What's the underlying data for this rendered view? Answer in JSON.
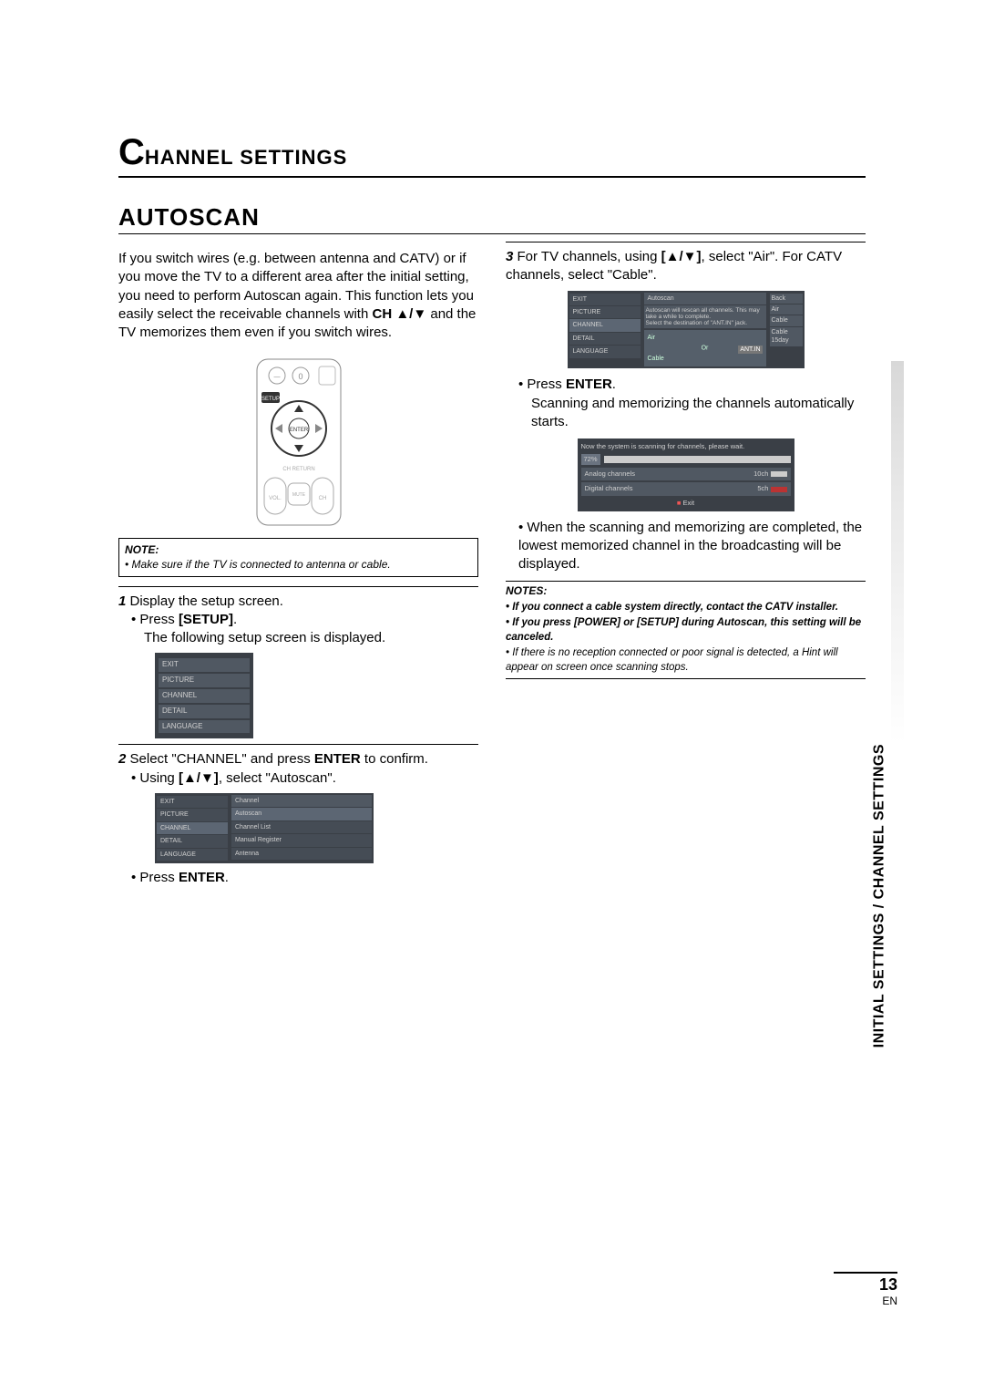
{
  "title": {
    "big": "C",
    "rest": "HANNEL SETTINGS"
  },
  "section": "AUTOSCAN",
  "side_tab": "INITIAL SETTINGS / CHANNEL SETTINGS",
  "intro": "If you switch wires (e.g. between antenna and CATV) or if you move the TV to a different area after the initial setting, you need to perform Autoscan again. This function lets you easily select the receivable channels with ",
  "intro_key": "CH ▲/▼",
  "intro2": " and the TV memorizes them even if you switch wires.",
  "note_title": "NOTE:",
  "note_body": "• Make sure if the TV is connected to antenna or cable.",
  "step1": {
    "n": "1",
    "text": "Display the setup screen."
  },
  "step1_b1a": "Press ",
  "step1_b1b": "[SETUP]",
  "step1_b1c": ".",
  "step1_line2": "The following setup screen is displayed.",
  "menu1": [
    "EXIT",
    "PICTURE",
    "CHANNEL",
    "DETAIL",
    "LANGUAGE"
  ],
  "step2": {
    "n": "2",
    "a": "Select \"CHANNEL\" and press ",
    "b": "ENTER",
    "c": " to confirm."
  },
  "step2_b1a": "Using ",
  "step2_b1b": "[▲/▼]",
  "step2_b1c": ", select \"Autoscan\".",
  "menu2_left": [
    "EXIT",
    "PICTURE",
    "CHANNEL",
    "DETAIL",
    "LANGUAGE"
  ],
  "menu2_header": "Channel",
  "menu2_items": [
    "Autoscan",
    "Channel List",
    "Manual Register",
    "Antenna"
  ],
  "step2_foot_a": "Press ",
  "step2_foot_b": "ENTER",
  "step2_foot_c": ".",
  "step3": {
    "n": "3",
    "a": "For TV channels, using ",
    "b": "[▲/▼]",
    "c": ", select \"Air\". For CATV channels, select \"Cable\"."
  },
  "auto_left": [
    "EXIT",
    "PICTURE",
    "CHANNEL",
    "DETAIL",
    "LANGUAGE"
  ],
  "auto_header": "Autoscan",
  "auto_info1": "Autoscan will rescan all channels. This may take a while to complete.",
  "auto_info2": "Select the destination of \"ANT.IN\" jack.",
  "auto_side": [
    "Back",
    "Air",
    "Cable",
    "Cable  15day"
  ],
  "auto_air": "Air",
  "auto_cable": "Cable",
  "auto_or": "Or",
  "auto_ant": "ANT.IN",
  "step3_b1a": "Press ",
  "step3_b1b": "ENTER",
  "step3_b1c": ".",
  "step3_line2": "Scanning and memorizing the channels automatically starts.",
  "scan_msg": "Now the system is scanning for channels, please wait.",
  "scan_pct": "72%",
  "scan_a_label": "Analog channels",
  "scan_a_val": "10ch",
  "scan_d_label": "Digital channels",
  "scan_d_val": "5ch",
  "scan_exit": "Exit",
  "step3_after": "When the scanning and memorizing are completed, the lowest memorized channel in the broadcasting will be displayed.",
  "notes_h": "NOTES:",
  "notes_i1": "• If you connect a cable system directly, contact the CATV installer.",
  "notes_i2": "• If you press [POWER] or [SETUP] during Autoscan, this setting will be canceled.",
  "notes_i3": "• If there is no reception connected or poor signal is detected, a Hint will appear on screen once scanning stops.",
  "page_number": "13",
  "page_lang": "EN"
}
